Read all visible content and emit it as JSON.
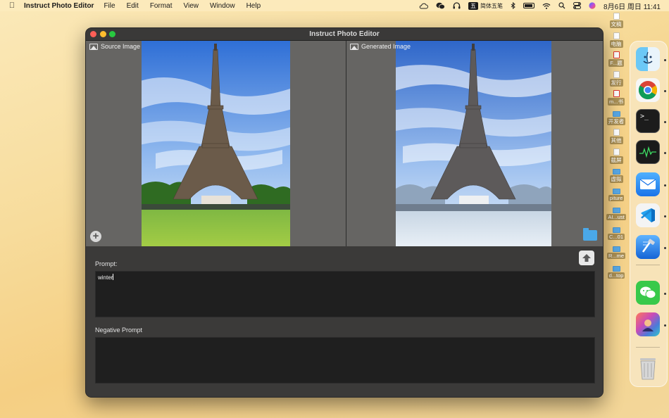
{
  "menubar": {
    "app_name": "Instruct Photo Editor",
    "menus": [
      "File",
      "Edit",
      "Format",
      "View",
      "Window",
      "Help"
    ],
    "ime_badge": "五",
    "ime_label": "简体五笔",
    "datetime": "8月6日 周日 11:41"
  },
  "desktop": {
    "items": [
      {
        "label": "文稿",
        "kind": "doc"
      },
      {
        "label": "电脑",
        "kind": "doc"
      },
      {
        "label": "F...题",
        "kind": "pdf"
      },
      {
        "label": "发行",
        "kind": "doc"
      },
      {
        "label": "m...书",
        "kind": "pdf"
      },
      {
        "label": "开发者",
        "kind": "folder"
      },
      {
        "label": "其他",
        "kind": "doc"
      },
      {
        "label": "截屏",
        "kind": "doc"
      },
      {
        "label": "虚拟",
        "kind": "folder"
      },
      {
        "label": "piture",
        "kind": "folder"
      },
      {
        "label": "AI...ust",
        "kind": "folder"
      },
      {
        "label": "C...01",
        "kind": "folder"
      },
      {
        "label": "R...me",
        "kind": "folder"
      },
      {
        "label": "d...top",
        "kind": "folder"
      }
    ]
  },
  "dock": {
    "apps": [
      "finder-icon",
      "chrome-icon",
      "terminal-icon",
      "activity-monitor-icon",
      "mail-icon",
      "vscode-icon",
      "xcode-icon",
      "wechat-icon",
      "photo-editor-icon"
    ],
    "trash": "trash-icon"
  },
  "window": {
    "title": "Instruct Photo Editor",
    "source_label": "Source Image",
    "generated_label": "Generated Image",
    "prompt_label": "Prompt:",
    "prompt_value": "winter",
    "negative_label": "Negative Prompt",
    "negative_value": ""
  },
  "colors": {
    "accent_folder": "#4aa8e8",
    "close": "#ff5f57",
    "minimize": "#febc2e",
    "maximize": "#28c840"
  }
}
